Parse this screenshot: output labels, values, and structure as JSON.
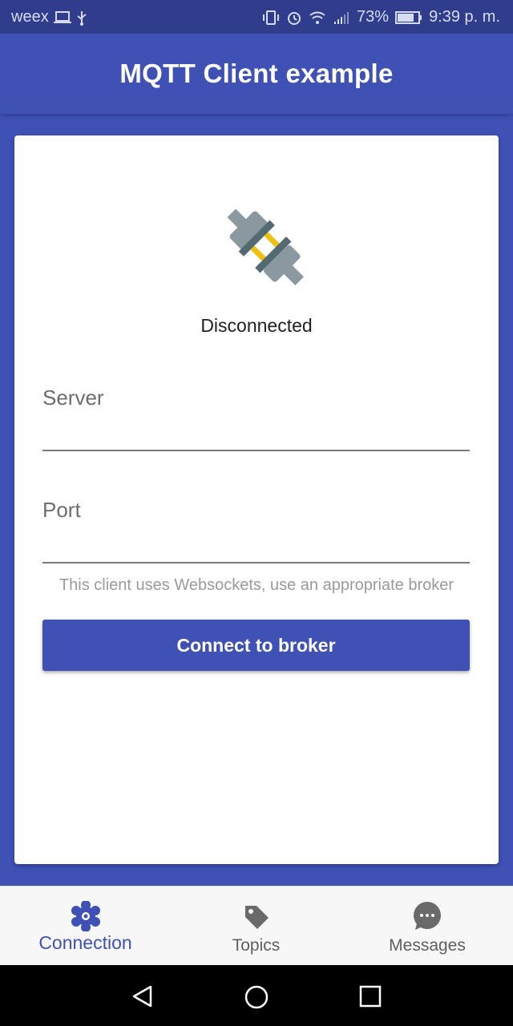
{
  "status_bar": {
    "carrier": "weex",
    "battery": "73%",
    "time": "9:39 p. m."
  },
  "app_bar": {
    "title": "MQTT Client example"
  },
  "connection": {
    "status": "Disconnected",
    "icon": "plug-icon"
  },
  "form": {
    "server_label": "Server",
    "server_value": "",
    "port_label": "Port",
    "port_value": "",
    "hint": "This client uses Websockets, use an appropriate broker",
    "connect_button": "Connect to broker"
  },
  "bottom_nav": {
    "items": [
      {
        "label": "Connection",
        "icon": "gear-icon",
        "active": true
      },
      {
        "label": "Topics",
        "icon": "tag-icon",
        "active": false
      },
      {
        "label": "Messages",
        "icon": "chat-bubble-icon",
        "active": false
      }
    ]
  },
  "colors": {
    "primary": "#3f51b5",
    "status_bar": "#2f3d8c",
    "card": "#ffffff"
  }
}
